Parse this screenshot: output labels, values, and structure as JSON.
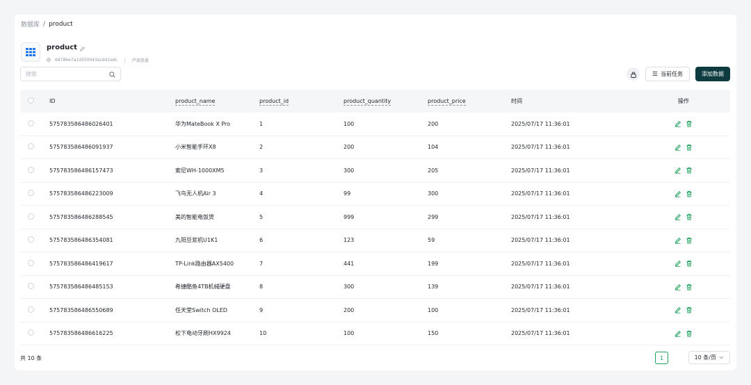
{
  "breadcrumb": {
    "root": "数据库",
    "separator": "/",
    "current": "product"
  },
  "header": {
    "title": "product",
    "id_text": "68786e7a1d350043acd42adc",
    "description": "产品信息"
  },
  "search": {
    "placeholder": "搜索"
  },
  "toolbar": {
    "tasks_label": "当前任务",
    "add_label": "添加数据"
  },
  "table": {
    "columns": [
      "ID",
      "product_name",
      "product_id",
      "product_quantity",
      "product_price",
      "时间",
      "操作"
    ],
    "rows": [
      [
        "575783586486026401",
        "华为MateBook X Pro",
        "1",
        "100",
        "200",
        "2025/07/17 11:36:01"
      ],
      [
        "575783586486091937",
        "小米智能手环X8",
        "2",
        "200",
        "104",
        "2025/07/17 11:36:01"
      ],
      [
        "575783586486157473",
        "索尼WH-1000XM5",
        "3",
        "300",
        "205",
        "2025/07/17 11:36:01"
      ],
      [
        "575783586486223009",
        "飞鸟无人机Air 3",
        "4",
        "99",
        "300",
        "2025/07/17 11:36:01"
      ],
      [
        "575783586486288545",
        "美的智能电饭煲",
        "5",
        "999",
        "299",
        "2025/07/17 11:36:01"
      ],
      [
        "575783586486354081",
        "九阳豆浆机U1K1",
        "6",
        "123",
        "59",
        "2025/07/17 11:36:01"
      ],
      [
        "575783586486419617",
        "TP-Link路由器AX5400",
        "7",
        "441",
        "199",
        "2025/07/17 11:36:01"
      ],
      [
        "575783586486485153",
        "希捷酷鱼4TB机械硬盘",
        "8",
        "300",
        "139",
        "2025/07/17 11:36:01"
      ],
      [
        "575783586486550689",
        "任天堂Switch OLED",
        "9",
        "200",
        "100",
        "2025/07/17 11:36:01"
      ],
      [
        "575783586486616225",
        "松下电动牙刷HX9924",
        "10",
        "100",
        "150",
        "2025/07/17 11:36:01"
      ]
    ]
  },
  "footer": {
    "total": "共 10 条",
    "page_number": "1",
    "page_size": "10 条/页"
  },
  "colors": {
    "accent": "#18a058",
    "primary_button": "#0d3b3f",
    "icon_blue": "#1a73e8"
  }
}
